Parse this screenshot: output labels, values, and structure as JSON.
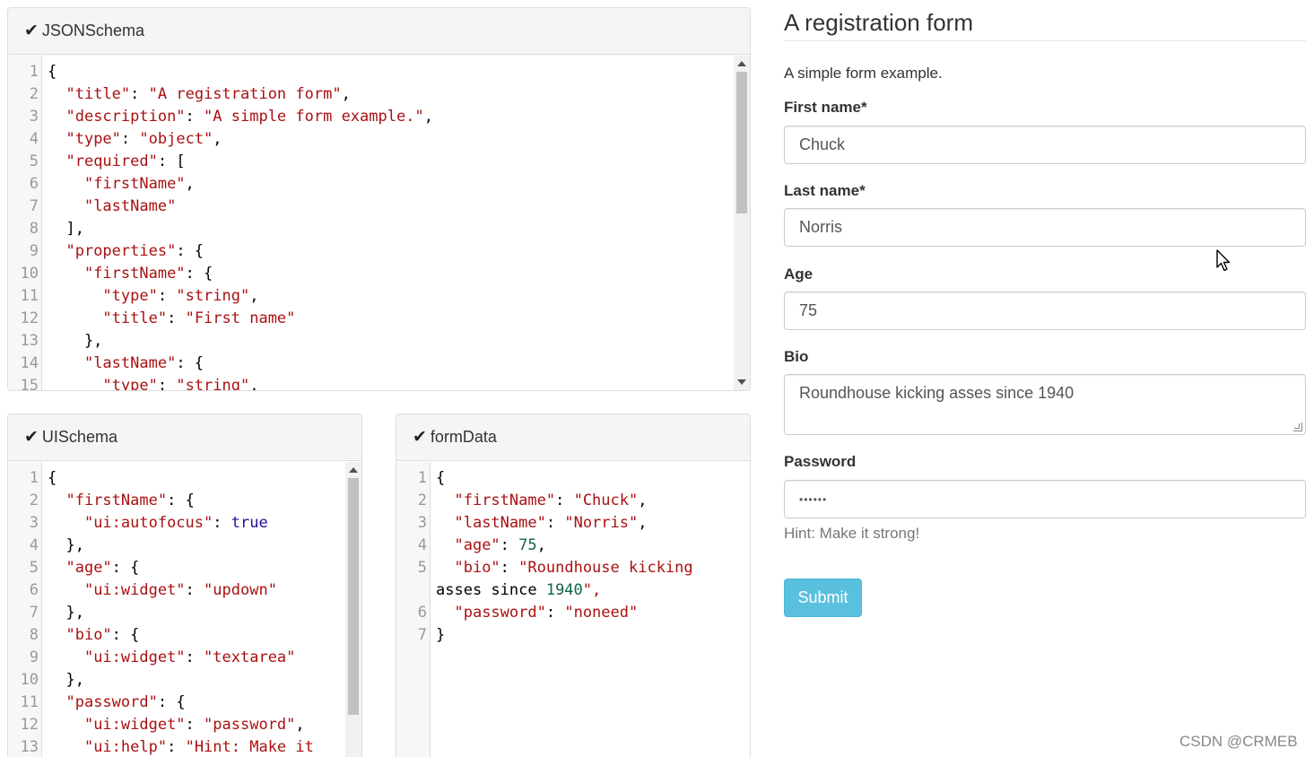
{
  "panels": {
    "jsonschema": {
      "title": "JSONSchema",
      "lines": [
        {
          "n": "1",
          "t": "{"
        },
        {
          "n": "2",
          "t": "  \"title\": \"A registration form\","
        },
        {
          "n": "3",
          "t": "  \"description\": \"A simple form example.\","
        },
        {
          "n": "4",
          "t": "  \"type\": \"object\","
        },
        {
          "n": "5",
          "t": "  \"required\": ["
        },
        {
          "n": "6",
          "t": "    \"firstName\","
        },
        {
          "n": "7",
          "t": "    \"lastName\""
        },
        {
          "n": "8",
          "t": "  ],"
        },
        {
          "n": "9",
          "t": "  \"properties\": {"
        },
        {
          "n": "10",
          "t": "    \"firstName\": {"
        },
        {
          "n": "11",
          "t": "      \"type\": \"string\","
        },
        {
          "n": "12",
          "t": "      \"title\": \"First name\""
        },
        {
          "n": "13",
          "t": "    },"
        },
        {
          "n": "14",
          "t": "    \"lastName\": {"
        },
        {
          "n": "15",
          "t": "      \"type\": \"string\","
        }
      ]
    },
    "uischema": {
      "title": "UISchema",
      "lines": [
        {
          "n": "1",
          "t": "{"
        },
        {
          "n": "2",
          "t": "  \"firstName\": {"
        },
        {
          "n": "3",
          "t": "    \"ui:autofocus\": true"
        },
        {
          "n": "4",
          "t": "  },"
        },
        {
          "n": "5",
          "t": "  \"age\": {"
        },
        {
          "n": "6",
          "t": "    \"ui:widget\": \"updown\""
        },
        {
          "n": "7",
          "t": "  },"
        },
        {
          "n": "8",
          "t": "  \"bio\": {"
        },
        {
          "n": "9",
          "t": "    \"ui:widget\": \"textarea\""
        },
        {
          "n": "10",
          "t": "  },"
        },
        {
          "n": "11",
          "t": "  \"password\": {"
        },
        {
          "n": "12",
          "t": "    \"ui:widget\": \"password\","
        },
        {
          "n": "13",
          "t": "    \"ui:help\": \"Hint: Make it"
        }
      ]
    },
    "formdata": {
      "title": "formData",
      "lines": [
        {
          "n": "1",
          "t": "{"
        },
        {
          "n": "2",
          "t": "  \"firstName\": \"Chuck\","
        },
        {
          "n": "3",
          "t": "  \"lastName\": \"Norris\","
        },
        {
          "n": "4",
          "t": "  \"age\": 75,"
        },
        {
          "n": "5",
          "t": "  \"bio\": \"Roundhouse kicking"
        },
        {
          "n": "",
          "t": "asses since 1940\","
        },
        {
          "n": "6",
          "t": "  \"password\": \"noneed\""
        },
        {
          "n": "7",
          "t": "}"
        }
      ]
    }
  },
  "form": {
    "title": "A registration form",
    "description": "A simple form example.",
    "first_name_label": "First name*",
    "first_name_value": "Chuck",
    "last_name_label": "Last name*",
    "last_name_value": "Norris",
    "age_label": "Age",
    "age_value": "75",
    "bio_label": "Bio",
    "bio_value": "Roundhouse kicking asses since 1940",
    "password_label": "Password",
    "password_value": "••••••",
    "password_hint": "Hint: Make it strong!",
    "submit_label": "Submit"
  },
  "watermark": "CSDN @CRMEB",
  "check_glyph": "✔"
}
